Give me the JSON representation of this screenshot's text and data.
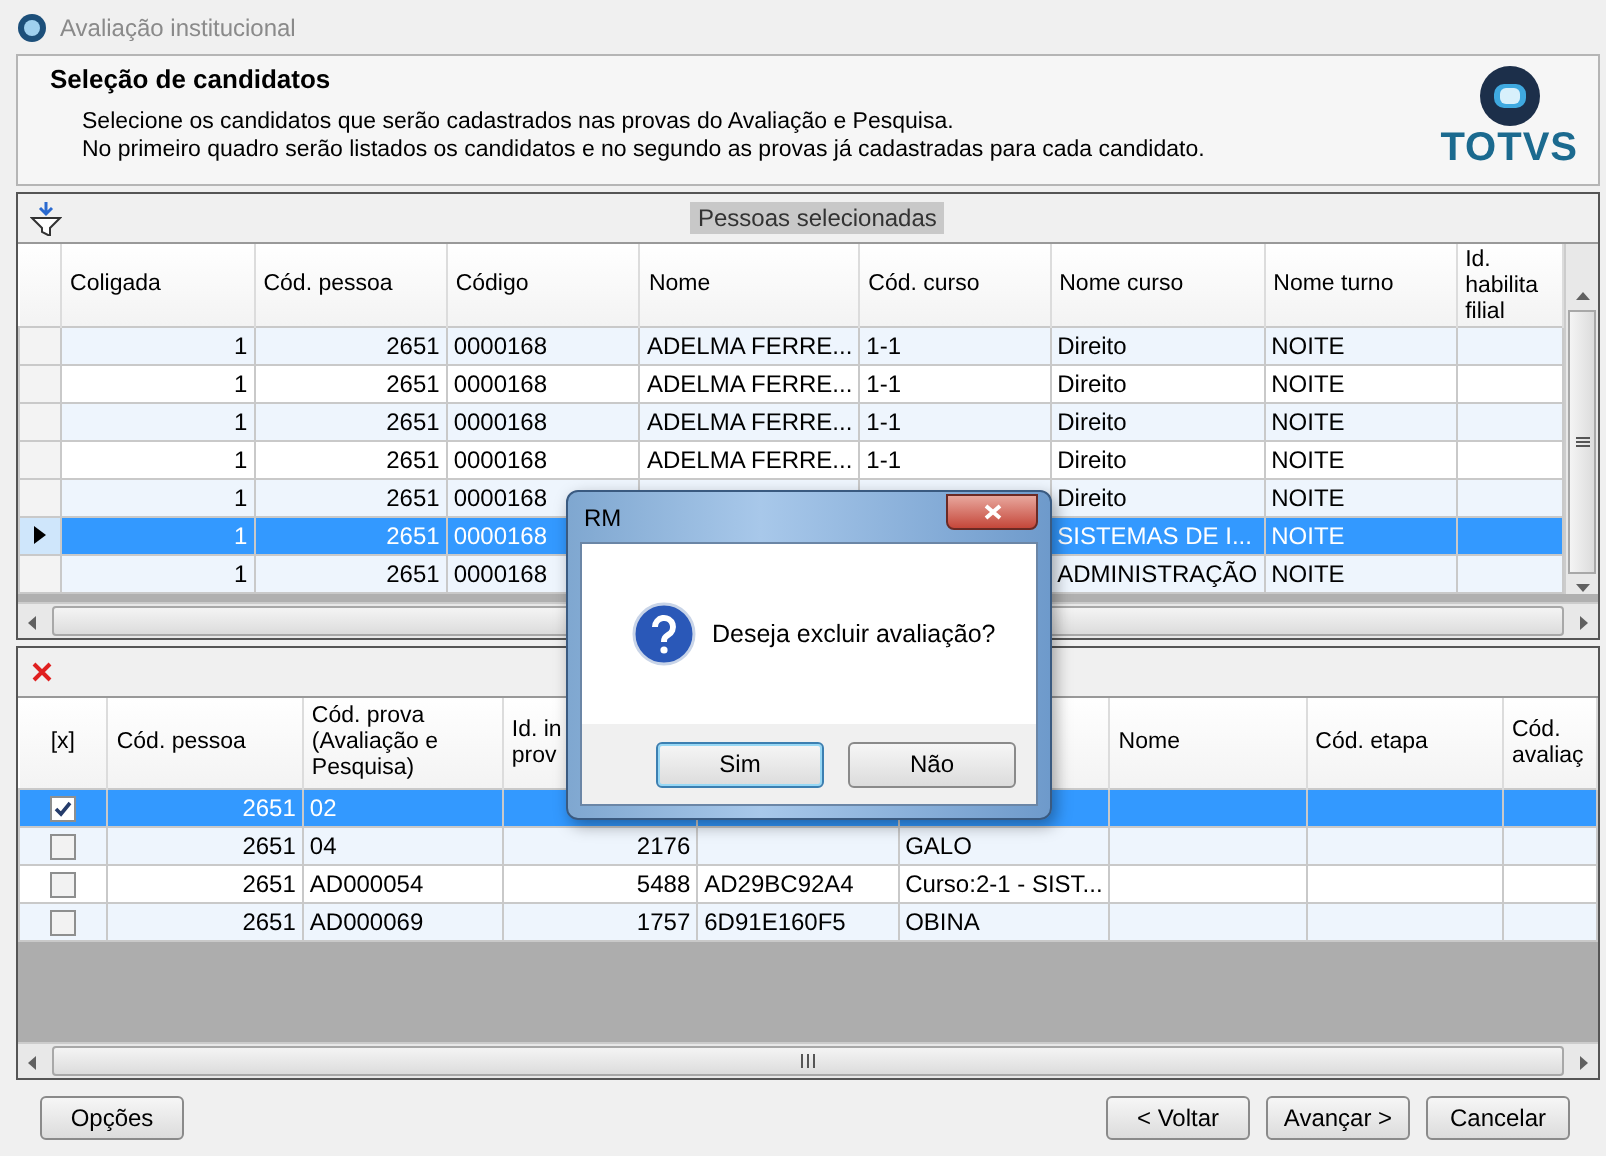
{
  "window": {
    "title": "Avaliação institucional"
  },
  "header": {
    "title": "Seleção de candidatos",
    "lines": [
      "Selecione os candidatos que serão cadastrados nas provas do Avaliação e Pesquisa.",
      "No primeiro quadro serão listados os candidatos e no segundo as provas já cadastradas para cada candidato."
    ],
    "logo": "TOTVS"
  },
  "candidates": {
    "caption": "Pessoas selecionadas",
    "columns": [
      "Coligada",
      "Cód. pessoa",
      "Código",
      "Nome",
      "Cód. curso",
      "Nome curso",
      "Nome turno",
      "Id. habilita filial"
    ],
    "rows": [
      {
        "selected": false,
        "cells": [
          "1",
          "2651",
          "0000168",
          "ADELMA FERRE...",
          "1-1",
          "Direito",
          "NOITE"
        ]
      },
      {
        "selected": false,
        "cells": [
          "1",
          "2651",
          "0000168",
          "ADELMA FERRE...",
          "1-1",
          "Direito",
          "NOITE"
        ]
      },
      {
        "selected": false,
        "cells": [
          "1",
          "2651",
          "0000168",
          "ADELMA FERRE...",
          "1-1",
          "Direito",
          "NOITE"
        ]
      },
      {
        "selected": false,
        "cells": [
          "1",
          "2651",
          "0000168",
          "ADELMA FERRE...",
          "1-1",
          "Direito",
          "NOITE"
        ]
      },
      {
        "selected": false,
        "cells": [
          "1",
          "2651",
          "0000168",
          null,
          null,
          "Direito",
          "NOITE"
        ]
      },
      {
        "selected": true,
        "cells": [
          "1",
          "2651",
          "0000168",
          null,
          null,
          "SISTEMAS DE I...",
          "NOITE"
        ]
      },
      {
        "selected": false,
        "cells": [
          "1",
          "2651",
          "0000168",
          null,
          null,
          "ADMINISTRAÇÃO",
          "NOITE"
        ]
      }
    ]
  },
  "exams": {
    "check_column": "[x]",
    "columns": [
      "Cód. pessoa",
      "Cód. prova (Avaliação e Pesquisa)",
      "Id. in prov",
      null,
      null,
      "Nome",
      "Cód. etapa",
      "Cód. avaliaç"
    ],
    "rows": [
      {
        "selected": true,
        "checked": true,
        "cells": [
          "2651",
          "02",
          null,
          null,
          null
        ]
      },
      {
        "selected": false,
        "checked": false,
        "cells": [
          "2651",
          "04",
          "2176",
          null,
          "GALO"
        ]
      },
      {
        "selected": false,
        "checked": false,
        "cells": [
          "2651",
          "AD000054",
          "5488",
          "AD29BC92A4",
          "Curso:2-1 - SIST..."
        ]
      },
      {
        "selected": false,
        "checked": false,
        "cells": [
          "2651",
          "AD000069",
          "1757",
          "6D91E160F5",
          "OBINA"
        ]
      }
    ]
  },
  "dialog": {
    "title": "RM",
    "message": "Deseja excluir avaliação?",
    "buttons": [
      {
        "label": "Sim",
        "default": true
      },
      {
        "label": "Não",
        "default": false
      }
    ]
  },
  "footer": {
    "options": "Opções",
    "buttons": [
      "< Voltar",
      "Avançar >",
      "Cancelar"
    ]
  }
}
